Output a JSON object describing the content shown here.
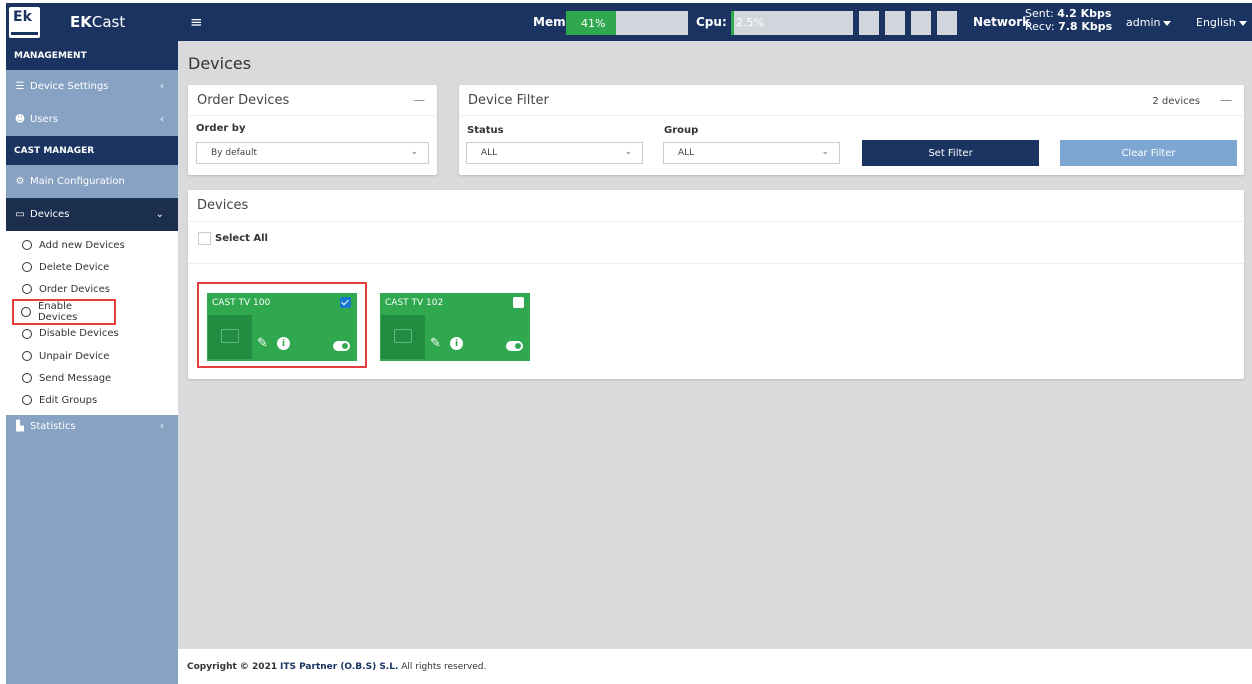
{
  "app": {
    "logo_text": "Ek",
    "brand_bold": "EK",
    "brand_rest": "Cast",
    "accent": "#2fa84f",
    "navy": "#1a3361"
  },
  "topbar": {
    "menu_icon": "hamburger-icon",
    "mem_label": "Mem:",
    "mem_value": "41%",
    "mem_fraction": 0.41,
    "cpu_label": "Cpu:",
    "cpu_value": "2.5%",
    "cpu_fraction": 0.025,
    "network_label": "Network",
    "sent_label": "Sent:",
    "sent_value": "4.2 Kbps",
    "recv_label": "Recv:",
    "recv_value": "7.8 Kbps",
    "user": "admin",
    "language": "English"
  },
  "sidebar": {
    "management_header": "MANAGEMENT",
    "device_settings": "Device Settings",
    "users": "Users",
    "cast_manager_header": "CAST MANAGER",
    "main_configuration": "Main Configuration",
    "devices": "Devices",
    "sub_items": [
      "Add new Devices",
      "Delete Device",
      "Order Devices",
      "Enable Devices",
      "Disable Devices",
      "Unpair Device",
      "Send Message",
      "Edit Groups"
    ],
    "statistics": "Statistics"
  },
  "main": {
    "page_title": "Devices",
    "order_card": {
      "title": "Order Devices",
      "order_by_label": "Order by",
      "order_by_value": "By default"
    },
    "filter_card": {
      "title": "Device Filter",
      "count": "2 devices",
      "status_label": "Status",
      "status_value": "ALL",
      "group_label": "Group",
      "group_value": "ALL",
      "set_filter": "Set Filter",
      "clear_filter": "Clear Filter"
    },
    "devices_card": {
      "title": "Devices",
      "select_all": "Select All",
      "devices": [
        {
          "name": "CAST TV 100",
          "checked": true,
          "enabled": true
        },
        {
          "name": "CAST TV 102",
          "checked": false,
          "enabled": true
        }
      ]
    }
  },
  "footer": {
    "prefix": "Copyright © 2021",
    "company": "ITS Partner (O.B.S) S.L.",
    "suffix": "All rights reserved."
  }
}
